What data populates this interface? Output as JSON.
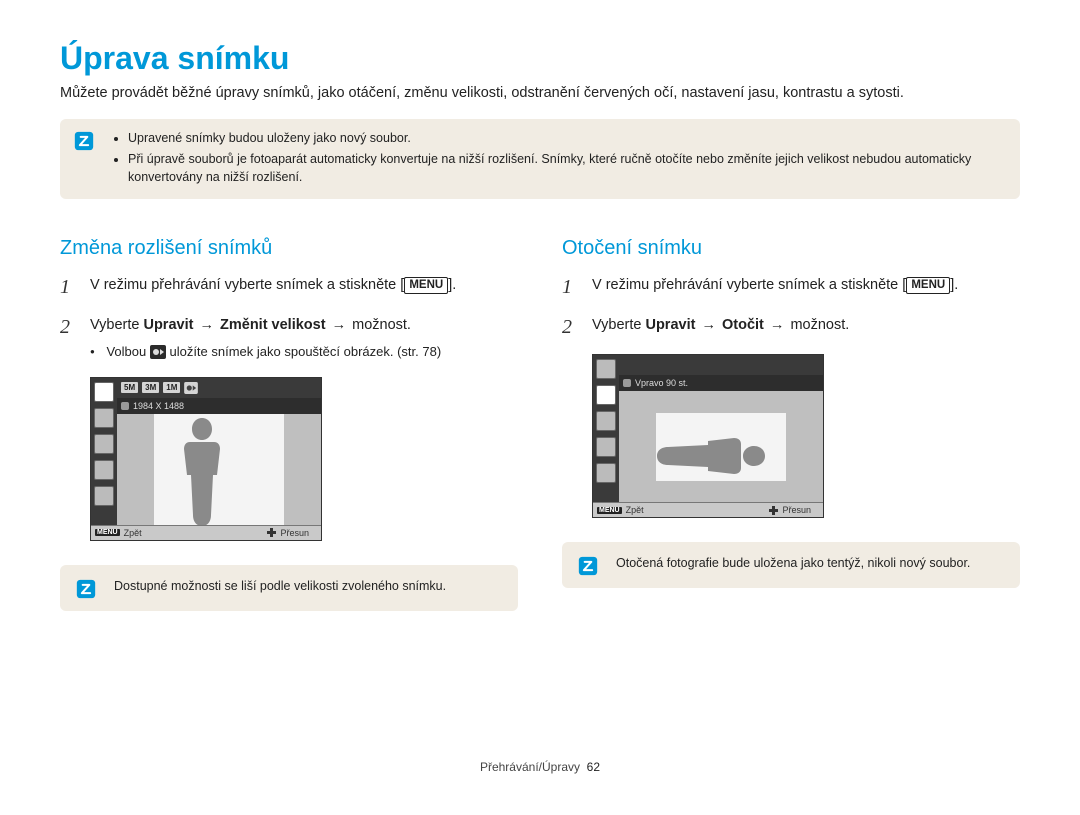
{
  "title": "Úprava snímku",
  "intro": "Můžete provádět běžné úpravy snímků, jako otáčení, změnu velikosti, odstranění červených očí, nastavení jasu, kontrastu a sytosti.",
  "info_note": {
    "items": [
      "Upravené snímky budou uloženy jako nový soubor.",
      "Při úpravě souborů je fotoaparát automaticky konvertuje na nižší rozlišení. Snímky, které ručně otočíte nebo změníte jejich velikost nebudou automaticky konvertovány na nižší rozlišení."
    ]
  },
  "sections": {
    "resize": {
      "heading": "Změna rozlišení snímků",
      "step1_prefix": "V režimu přehrávání vyberte snímek a stiskněte [",
      "step1_menu": "MENU",
      "step1_suffix": "].",
      "step2_prefix": "Vyberte ",
      "step2_b1": "Upravit",
      "step2_arrow1": "→",
      "step2_b2": "Změnit velikost",
      "step2_arrow2": "→",
      "step2_suffix": " možnost.",
      "sub_bullet_prefix": "Volbou ",
      "sub_bullet_suffix": " uložíte snímek jako spouštěcí obrázek. (str. 78)",
      "lcd_res_label": "1984 X 1488",
      "lcd_back": "Zpět",
      "lcd_move": "Přesun",
      "lcd_menu": "MENU",
      "lcd_chips": [
        "5M",
        "3M",
        "1M"
      ],
      "note": "Dostupné možnosti se liší podle velikosti zvoleného snímku."
    },
    "rotate": {
      "heading": "Otočení snímku",
      "step1_prefix": "V režimu přehrávání vyberte snímek a stiskněte [",
      "step1_menu": "MENU",
      "step1_suffix": "].",
      "step2_prefix": "Vyberte ",
      "step2_b1": "Upravit",
      "step2_arrow1": "→",
      "step2_b2": "Otočit",
      "step2_arrow2": "→",
      "step2_suffix": " možnost.",
      "lcd_rot_label": "Vpravo 90 st.",
      "lcd_back": "Zpět",
      "lcd_move": "Přesun",
      "lcd_menu": "MENU",
      "note": "Otočená fotografie bude uložena jako tentýž, nikoli nový soubor."
    }
  },
  "footer_section": "Přehrávání/Úpravy",
  "footer_page": "62"
}
